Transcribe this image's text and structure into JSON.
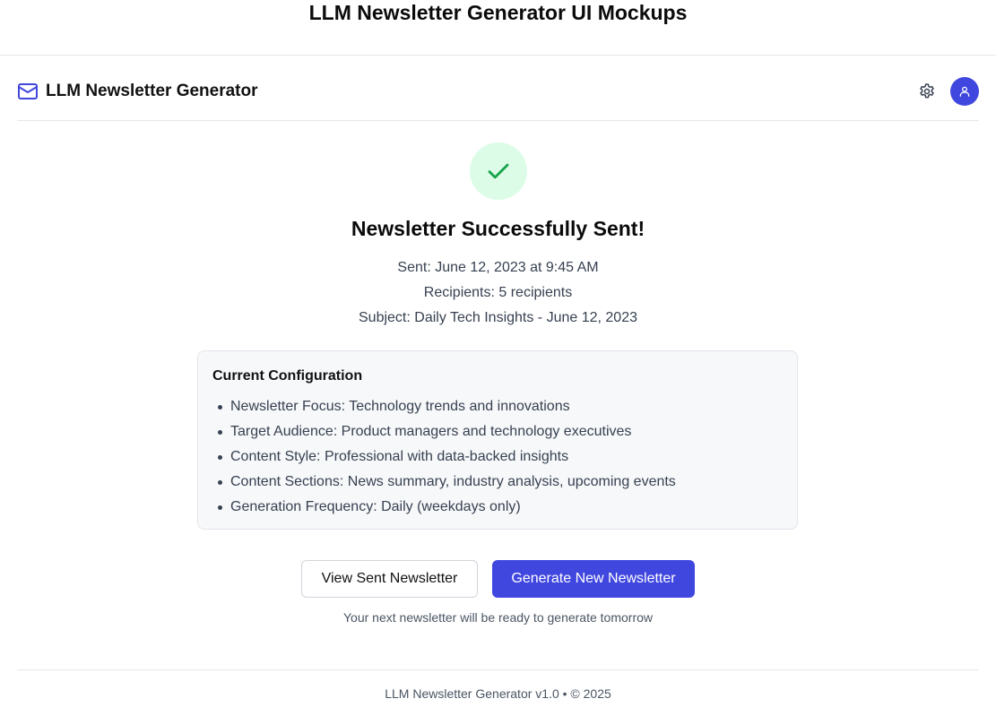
{
  "page": {
    "title": "LLM Newsletter Generator UI Mockups"
  },
  "header": {
    "app_name": "LLM Newsletter Generator",
    "icons": {
      "brand": "mail-icon",
      "settings": "gear-icon",
      "avatar": "user-icon"
    },
    "accent_color": "#4047df"
  },
  "success": {
    "icon": "check-icon",
    "title": "Newsletter Successfully Sent!",
    "sent": "Sent: June 12, 2023 at 9:45 AM",
    "recipients": "Recipients: 5 recipients",
    "subject": "Subject: Daily Tech Insights - June 12, 2023",
    "color": "#16a34a"
  },
  "config": {
    "title": "Current Configuration",
    "items": [
      "Newsletter Focus: Technology trends and innovations",
      "Target Audience: Product managers and technology executives",
      "Content Style: Professional with data-backed insights",
      "Content Sections: News summary, industry analysis, upcoming events",
      "Generation Frequency: Daily (weekdays only)"
    ]
  },
  "actions": {
    "view_label": "View Sent Newsletter",
    "generate_label": "Generate New Newsletter",
    "hint": "Your next newsletter will be ready to generate tomorrow"
  },
  "footer": {
    "text": "LLM Newsletter Generator v1.0 • © 2025"
  }
}
